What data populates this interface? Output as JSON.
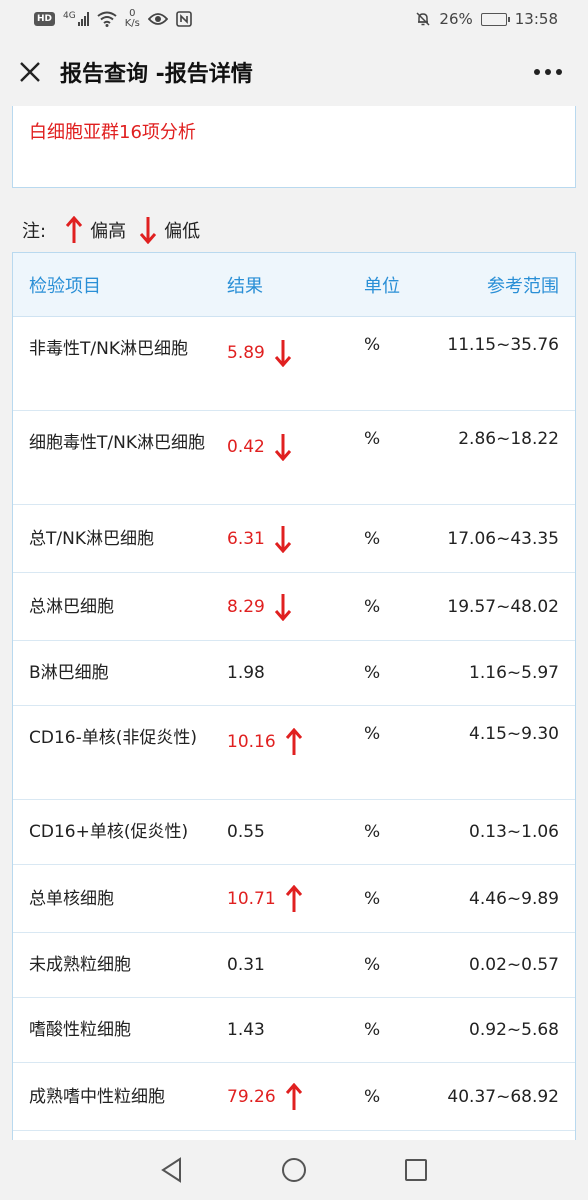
{
  "status_bar": {
    "network_badge": "HD",
    "network_type": "4G",
    "speed_value": "0",
    "speed_unit": "K/s",
    "battery": "26%",
    "battery_level": 0.26,
    "time": "13:58"
  },
  "header": {
    "title": "报告查询 -报告详情"
  },
  "report": {
    "name": "白细胞亚群16项分析"
  },
  "legend": {
    "note": "注:",
    "high": "偏高",
    "low": "偏低"
  },
  "table": {
    "headers": {
      "name": "检验项目",
      "result": "结果",
      "unit": "单位",
      "range": "参考范围"
    },
    "rows": [
      {
        "name": "非毒性T/NK淋巴细胞",
        "result": "5.89",
        "flag": "low",
        "unit": "%",
        "range": "11.15~35.76"
      },
      {
        "name": "细胞毒性T/NK淋巴细胞",
        "result": "0.42",
        "flag": "low",
        "unit": "%",
        "range": "2.86~18.22"
      },
      {
        "name": "总T/NK淋巴细胞",
        "result": "6.31",
        "flag": "low",
        "unit": "%",
        "range": "17.06~43.35"
      },
      {
        "name": "总淋巴细胞",
        "result": "8.29",
        "flag": "low",
        "unit": "%",
        "range": "19.57~48.02"
      },
      {
        "name": "B淋巴细胞",
        "result": "1.98",
        "flag": "",
        "unit": "%",
        "range": "1.16~5.97"
      },
      {
        "name": "CD16-单核(非促炎性)",
        "result": "10.16",
        "flag": "high",
        "unit": "%",
        "range": "4.15~9.30"
      },
      {
        "name": "CD16+单核(促炎性)",
        "result": "0.55",
        "flag": "",
        "unit": "%",
        "range": "0.13~1.06"
      },
      {
        "name": "总单核细胞",
        "result": "10.71",
        "flag": "high",
        "unit": "%",
        "range": "4.46~9.89"
      },
      {
        "name": "未成熟粒细胞",
        "result": "0.31",
        "flag": "",
        "unit": "%",
        "range": "0.02~0.57"
      },
      {
        "name": "嗜酸性粒细胞",
        "result": "1.43",
        "flag": "",
        "unit": "%",
        "range": "0.92~5.68"
      },
      {
        "name": "成熟嗜中性粒细胞",
        "result": "79.26",
        "flag": "high",
        "unit": "%",
        "range": "40.37~68.92"
      }
    ]
  },
  "colors": {
    "abnormal": "#e02020",
    "header_text": "#2a8fd6",
    "table_border": "#b9d9ef"
  }
}
